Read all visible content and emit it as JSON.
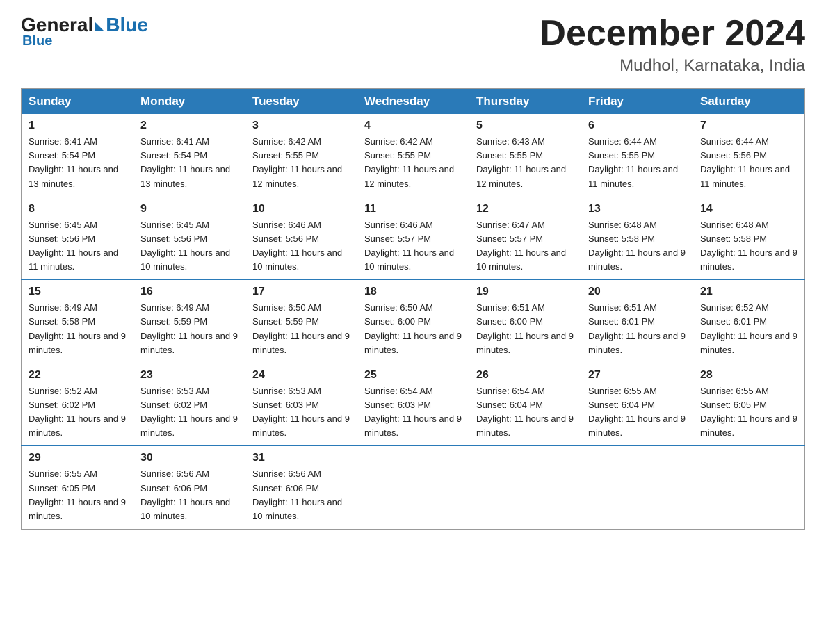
{
  "header": {
    "logo": {
      "general": "General",
      "blue": "Blue"
    },
    "title": "December 2024",
    "location": "Mudhol, Karnataka, India"
  },
  "weekdays": [
    "Sunday",
    "Monday",
    "Tuesday",
    "Wednesday",
    "Thursday",
    "Friday",
    "Saturday"
  ],
  "weeks": [
    [
      {
        "day": 1,
        "sunrise": "6:41 AM",
        "sunset": "5:54 PM",
        "daylight": "11 hours and 13 minutes."
      },
      {
        "day": 2,
        "sunrise": "6:41 AM",
        "sunset": "5:54 PM",
        "daylight": "11 hours and 13 minutes."
      },
      {
        "day": 3,
        "sunrise": "6:42 AM",
        "sunset": "5:55 PM",
        "daylight": "11 hours and 12 minutes."
      },
      {
        "day": 4,
        "sunrise": "6:42 AM",
        "sunset": "5:55 PM",
        "daylight": "11 hours and 12 minutes."
      },
      {
        "day": 5,
        "sunrise": "6:43 AM",
        "sunset": "5:55 PM",
        "daylight": "11 hours and 12 minutes."
      },
      {
        "day": 6,
        "sunrise": "6:44 AM",
        "sunset": "5:55 PM",
        "daylight": "11 hours and 11 minutes."
      },
      {
        "day": 7,
        "sunrise": "6:44 AM",
        "sunset": "5:56 PM",
        "daylight": "11 hours and 11 minutes."
      }
    ],
    [
      {
        "day": 8,
        "sunrise": "6:45 AM",
        "sunset": "5:56 PM",
        "daylight": "11 hours and 11 minutes."
      },
      {
        "day": 9,
        "sunrise": "6:45 AM",
        "sunset": "5:56 PM",
        "daylight": "11 hours and 10 minutes."
      },
      {
        "day": 10,
        "sunrise": "6:46 AM",
        "sunset": "5:56 PM",
        "daylight": "11 hours and 10 minutes."
      },
      {
        "day": 11,
        "sunrise": "6:46 AM",
        "sunset": "5:57 PM",
        "daylight": "11 hours and 10 minutes."
      },
      {
        "day": 12,
        "sunrise": "6:47 AM",
        "sunset": "5:57 PM",
        "daylight": "11 hours and 10 minutes."
      },
      {
        "day": 13,
        "sunrise": "6:48 AM",
        "sunset": "5:58 PM",
        "daylight": "11 hours and 9 minutes."
      },
      {
        "day": 14,
        "sunrise": "6:48 AM",
        "sunset": "5:58 PM",
        "daylight": "11 hours and 9 minutes."
      }
    ],
    [
      {
        "day": 15,
        "sunrise": "6:49 AM",
        "sunset": "5:58 PM",
        "daylight": "11 hours and 9 minutes."
      },
      {
        "day": 16,
        "sunrise": "6:49 AM",
        "sunset": "5:59 PM",
        "daylight": "11 hours and 9 minutes."
      },
      {
        "day": 17,
        "sunrise": "6:50 AM",
        "sunset": "5:59 PM",
        "daylight": "11 hours and 9 minutes."
      },
      {
        "day": 18,
        "sunrise": "6:50 AM",
        "sunset": "6:00 PM",
        "daylight": "11 hours and 9 minutes."
      },
      {
        "day": 19,
        "sunrise": "6:51 AM",
        "sunset": "6:00 PM",
        "daylight": "11 hours and 9 minutes."
      },
      {
        "day": 20,
        "sunrise": "6:51 AM",
        "sunset": "6:01 PM",
        "daylight": "11 hours and 9 minutes."
      },
      {
        "day": 21,
        "sunrise": "6:52 AM",
        "sunset": "6:01 PM",
        "daylight": "11 hours and 9 minutes."
      }
    ],
    [
      {
        "day": 22,
        "sunrise": "6:52 AM",
        "sunset": "6:02 PM",
        "daylight": "11 hours and 9 minutes."
      },
      {
        "day": 23,
        "sunrise": "6:53 AM",
        "sunset": "6:02 PM",
        "daylight": "11 hours and 9 minutes."
      },
      {
        "day": 24,
        "sunrise": "6:53 AM",
        "sunset": "6:03 PM",
        "daylight": "11 hours and 9 minutes."
      },
      {
        "day": 25,
        "sunrise": "6:54 AM",
        "sunset": "6:03 PM",
        "daylight": "11 hours and 9 minutes."
      },
      {
        "day": 26,
        "sunrise": "6:54 AM",
        "sunset": "6:04 PM",
        "daylight": "11 hours and 9 minutes."
      },
      {
        "day": 27,
        "sunrise": "6:55 AM",
        "sunset": "6:04 PM",
        "daylight": "11 hours and 9 minutes."
      },
      {
        "day": 28,
        "sunrise": "6:55 AM",
        "sunset": "6:05 PM",
        "daylight": "11 hours and 9 minutes."
      }
    ],
    [
      {
        "day": 29,
        "sunrise": "6:55 AM",
        "sunset": "6:05 PM",
        "daylight": "11 hours and 9 minutes."
      },
      {
        "day": 30,
        "sunrise": "6:56 AM",
        "sunset": "6:06 PM",
        "daylight": "11 hours and 10 minutes."
      },
      {
        "day": 31,
        "sunrise": "6:56 AM",
        "sunset": "6:06 PM",
        "daylight": "11 hours and 10 minutes."
      },
      null,
      null,
      null,
      null
    ]
  ]
}
